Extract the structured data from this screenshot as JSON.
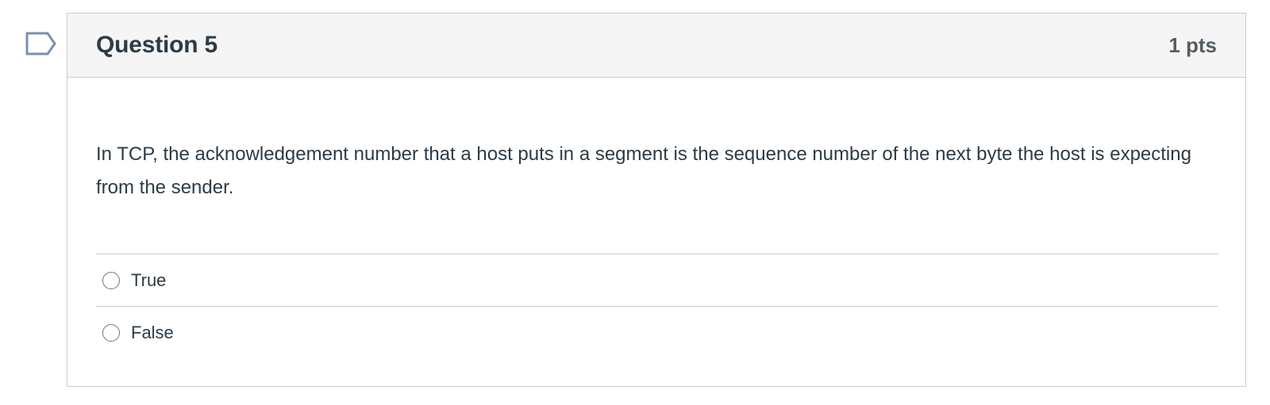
{
  "question": {
    "title": "Question 5",
    "points": "1 pts",
    "text": "In TCP, the acknowledgement number that a host puts in a segment is the sequence number of the next byte the host is expecting from the sender.",
    "answers": [
      {
        "label": "True",
        "selected": false
      },
      {
        "label": "False",
        "selected": false
      }
    ]
  },
  "colors": {
    "header_background": "#f5f5f5",
    "border": "#c7cdd1",
    "text": "#2d3b45",
    "flag_outline": "#7a92ad"
  },
  "icons": {
    "flag": "bookmark-flag-icon",
    "radio": "radio-unchecked-icon"
  }
}
